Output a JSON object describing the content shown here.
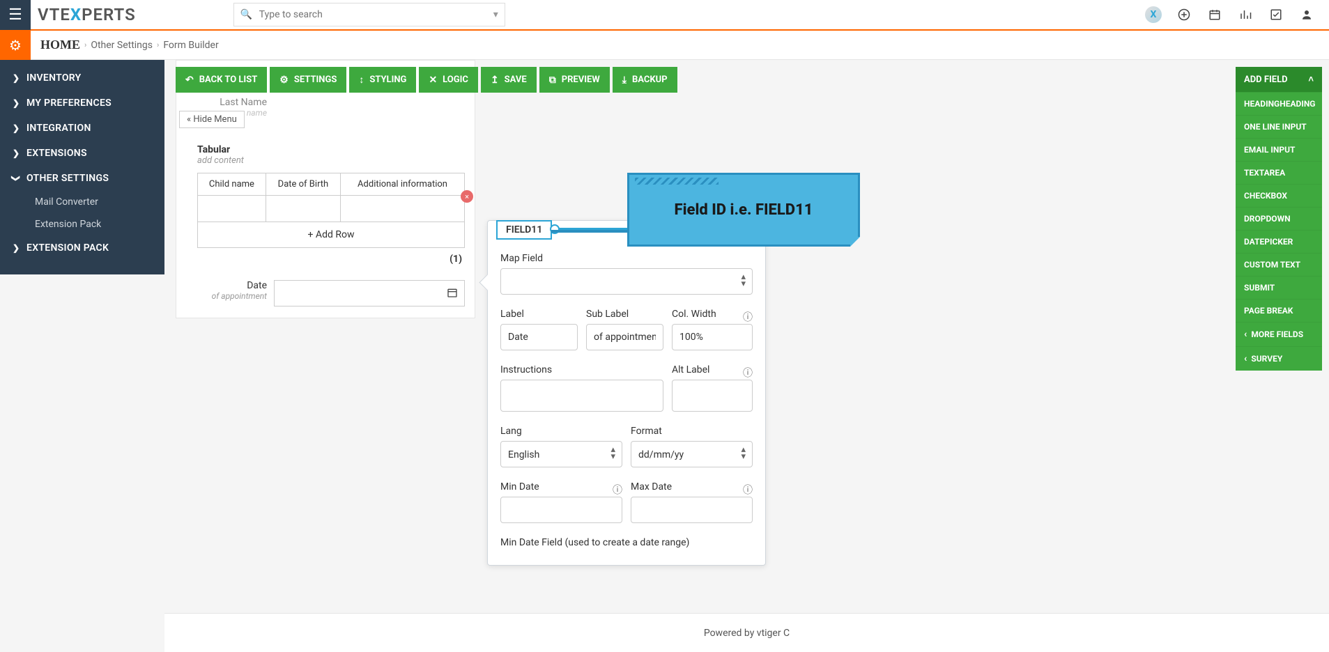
{
  "header": {
    "search_placeholder": "Type to search",
    "logo_segments": {
      "pre": "VTE",
      "blue": "X",
      "post": "PERTS"
    }
  },
  "breadcrumb": {
    "home": "HOME",
    "seg1": "Other Settings",
    "seg2": "Form Builder"
  },
  "sidebar": {
    "items": [
      {
        "label": "INVENTORY",
        "expanded": false
      },
      {
        "label": "MY PREFERENCES",
        "expanded": false
      },
      {
        "label": "INTEGRATION",
        "expanded": false
      },
      {
        "label": "EXTENSIONS",
        "expanded": false
      },
      {
        "label": "OTHER SETTINGS",
        "expanded": true,
        "children": [
          "Mail Converter",
          "Extension Pack"
        ]
      },
      {
        "label": "EXTENSION PACK",
        "expanded": false
      }
    ]
  },
  "toolbar": {
    "back": "BACK TO LIST",
    "settings": "SETTINGS",
    "styling": "STYLING",
    "logic": "LOGIC",
    "save": "SAVE",
    "preview": "PREVIEW",
    "backup": "BACKUP"
  },
  "form": {
    "hide_menu": "« Hide Menu",
    "last_name_label": "Last Name",
    "last_name_sub": "name",
    "tabular": {
      "title": "Tabular",
      "sub": "add content",
      "columns": [
        "Child name",
        "Date of Birth",
        "Additional information"
      ],
      "add_row": "+ Add Row",
      "row_count": "(1)"
    },
    "date_row": {
      "label": "Date",
      "sub": "of appointment"
    }
  },
  "field_panel": {
    "field_id": "FIELD11",
    "map_field_label": "Map Field",
    "label_label": "Label",
    "label_value": "Date",
    "sublabel_label": "Sub Label",
    "sublabel_value": "of appointment",
    "colwidth_label": "Col. Width",
    "colwidth_value": "100%",
    "instructions_label": "Instructions",
    "altlabel_label": "Alt Label",
    "lang_label": "Lang",
    "lang_value": "English",
    "format_label": "Format",
    "format_value": "dd/mm/yy",
    "mindate_label": "Min Date",
    "maxdate_label": "Max Date",
    "mindate_field_label": "Min Date Field (used to create a date range)"
  },
  "callout": {
    "text": "Field ID i.e. FIELD11"
  },
  "addfield": {
    "header": "ADD FIELD",
    "items": [
      "HEADINGHEADING",
      "ONE LINE INPUT",
      "EMAIL INPUT",
      "TEXTAREA",
      "CHECKBOX",
      "DROPDOWN",
      "DATEPICKER",
      "CUSTOM TEXT",
      "SUBMIT",
      "PAGE BREAK"
    ],
    "more_fields": "MORE FIELDS",
    "survey": "SURVEY"
  },
  "footer": {
    "text": "Powered by vtiger C"
  }
}
